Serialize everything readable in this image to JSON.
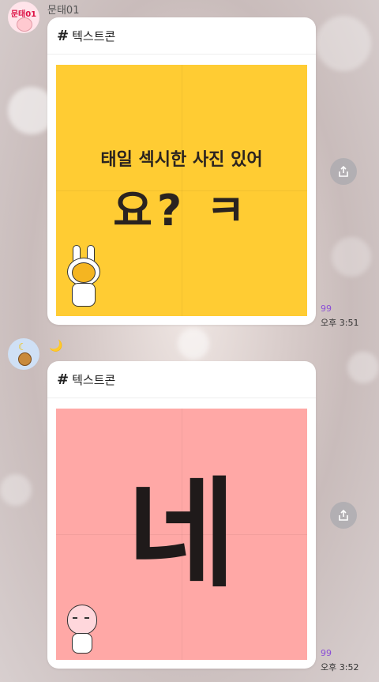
{
  "messages": [
    {
      "sender": "문태01",
      "avatar_text": "문태01",
      "tag": "텍스트콘",
      "sticker_line1": "태일 섹시한 사진 있어",
      "sticker_line2": "요? ㅋ",
      "sticker_color": "#ffcc33",
      "unread": "99",
      "time": "오후 3:51"
    },
    {
      "sender": "🌙",
      "tag": "텍스트콘",
      "sticker_text": "네",
      "sticker_color": "#ffa8a6",
      "unread": "99",
      "time": "오후 3:52"
    }
  ],
  "icons": {
    "share": "share-icon"
  }
}
